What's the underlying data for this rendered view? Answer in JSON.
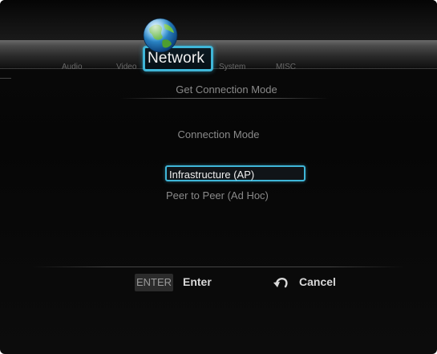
{
  "header": {
    "tabs": [
      {
        "label": "Audio"
      },
      {
        "label": "Video"
      },
      {
        "label": "Network",
        "active": true
      },
      {
        "label": "System"
      },
      {
        "label": "MISC"
      }
    ],
    "subtitle": "Get Connection Mode"
  },
  "main": {
    "section_label": "Connection Mode",
    "options": [
      {
        "label": "Infrastructure (AP)",
        "selected": true
      },
      {
        "label": "Peer to Peer (Ad Hoc)",
        "selected": false
      }
    ]
  },
  "footer": {
    "enter_key": "ENTER",
    "enter_label": "Enter",
    "cancel_label": "Cancel"
  },
  "colors": {
    "accent": "#3fb6d8",
    "background": "#080808",
    "text_dim": "#8a8a8a",
    "text_bright": "#f0f0f0"
  },
  "icons": {
    "network": "globe-icon",
    "cancel": "return-arrow-icon"
  }
}
